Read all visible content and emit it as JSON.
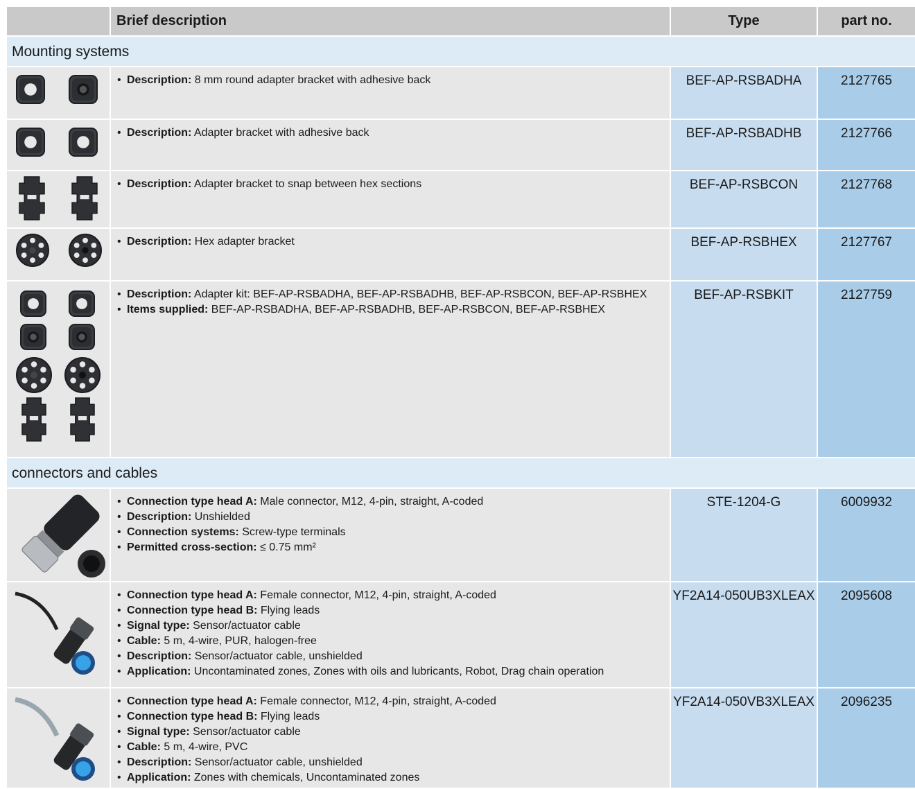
{
  "header": {
    "img": "",
    "desc": "Brief description",
    "type": "Type",
    "part": "part no."
  },
  "sections": [
    {
      "title": "Mounting systems",
      "rows": [
        {
          "icons": [
            "square-adapter-icon",
            "square-adapter-round-icon"
          ],
          "type": "BEF-AP-RSBADHA",
          "part": "2127765",
          "items": [
            {
              "label": "Description:",
              "value": " 8 mm round adapter bracket with adhesive back"
            }
          ]
        },
        {
          "icons": [
            "square-adapter-icon",
            "square-adapter-icon"
          ],
          "type": "BEF-AP-RSBADHB",
          "part": "2127766",
          "items": [
            {
              "label": "Description:",
              "value": " Adapter bracket with adhesive back"
            }
          ]
        },
        {
          "icons": [
            "snap-bracket-icon",
            "snap-bracket-icon"
          ],
          "type": "BEF-AP-RSBCON",
          "part": "2127768",
          "items": [
            {
              "label": "Description:",
              "value": " Adapter bracket to snap between hex sections"
            }
          ]
        },
        {
          "icons": [
            "hex-adapter-icon",
            "hex-adapter-icon"
          ],
          "type": "BEF-AP-RSBHEX",
          "part": "2127767",
          "items": [
            {
              "label": "Description:",
              "value": " Hex adapter bracket"
            }
          ]
        },
        {
          "icons": [
            "adapter-kit-icon"
          ],
          "type": "BEF-AP-RSBKIT",
          "part": "2127759",
          "items": [
            {
              "label": "Description:",
              "value": " Adapter kit: BEF-AP-RSBADHA, BEF-AP-RSBADHB, BEF-AP-RSBCON, BEF-AP-RSBHEX"
            },
            {
              "label": "Items supplied:",
              "value": " BEF-AP-RSBADHA, BEF-AP-RSBADHB, BEF-AP-RSBCON, BEF-AP-RSBHEX"
            }
          ]
        }
      ]
    },
    {
      "title": "connectors and cables",
      "rows": [
        {
          "icons": [
            "male-connector-icon"
          ],
          "type": "STE-1204-G",
          "part": "6009932",
          "items": [
            {
              "label": "Connection type head A:",
              "value": " Male connector, M12, 4-pin, straight, A-coded"
            },
            {
              "label": "Description:",
              "value": " Unshielded"
            },
            {
              "label": "Connection systems:",
              "value": " Screw-type terminals"
            },
            {
              "label": "Permitted cross-section:",
              "value": " ≤ 0.75 mm²"
            }
          ]
        },
        {
          "icons": [
            "cable-black-icon"
          ],
          "type": "YF2A14-050UB3XLEAX",
          "part": "2095608",
          "items": [
            {
              "label": "Connection type head A:",
              "value": " Female connector, M12, 4-pin, straight, A-coded"
            },
            {
              "label": "Connection type head B:",
              "value": " Flying leads"
            },
            {
              "label": "Signal type:",
              "value": " Sensor/actuator cable"
            },
            {
              "label": "Cable:",
              "value": " 5 m, 4-wire, PUR, halogen-free"
            },
            {
              "label": "Description:",
              "value": " Sensor/actuator cable, unshielded"
            },
            {
              "label": "Application:",
              "value": " Uncontaminated zones, Zones with oils and lubricants, Robot, Drag chain operation"
            }
          ]
        },
        {
          "icons": [
            "cable-grey-icon"
          ],
          "type": "YF2A14-050VB3XLEAX",
          "part": "2096235",
          "items": [
            {
              "label": "Connection type head A:",
              "value": " Female connector, M12, 4-pin, straight, A-coded"
            },
            {
              "label": "Connection type head B:",
              "value": " Flying leads"
            },
            {
              "label": "Signal type:",
              "value": " Sensor/actuator cable"
            },
            {
              "label": "Cable:",
              "value": " 5 m, 4-wire, PVC"
            },
            {
              "label": "Description:",
              "value": " Sensor/actuator cable, unshielded"
            },
            {
              "label": "Application:",
              "value": " Zones with chemicals, Uncontaminated zones"
            }
          ]
        }
      ]
    }
  ]
}
